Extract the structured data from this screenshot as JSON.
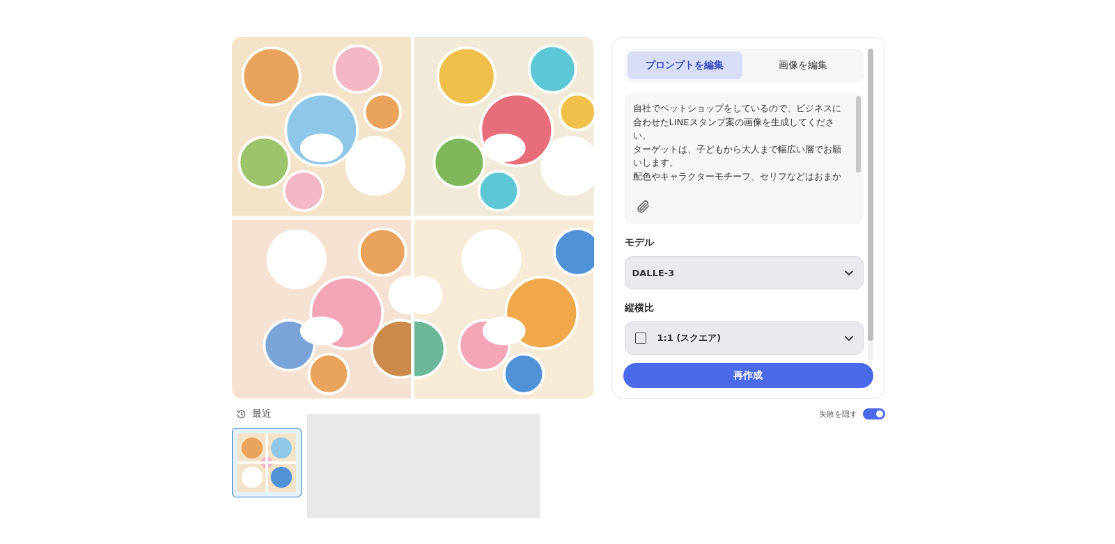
{
  "gallery": {
    "images": [
      {
        "kind": "picture"
      },
      {
        "kind": "picture"
      },
      {
        "kind": "picture"
      },
      {
        "kind": "picture"
      }
    ]
  },
  "panel": {
    "tabs": [
      {
        "label": "プロンプトを編集",
        "selected": true
      },
      {
        "label": "画像を編集",
        "selected": false
      }
    ],
    "prompt": {
      "paragraphs": [
        "自社でペットショップをしているので、ビジネスに合わせたLINEスタンプ案の画像を生成してください。",
        "ターゲットは、子どもから大人まで幅広い層でお願いします。",
        "配色やキャラクターモチーフ、セリフなどはおまか"
      ]
    },
    "model": {
      "label": "モデル",
      "value": "DALLE-3"
    },
    "aspect": {
      "label": "縦横比",
      "value": "1:1 (スクエア)"
    },
    "regenerate_button": "再作成"
  },
  "recent": {
    "title": "最近",
    "hide_failed": {
      "label": "失敗を隠す",
      "on": true
    },
    "items": [
      {
        "kind": "picture",
        "selected": true
      }
    ]
  }
}
